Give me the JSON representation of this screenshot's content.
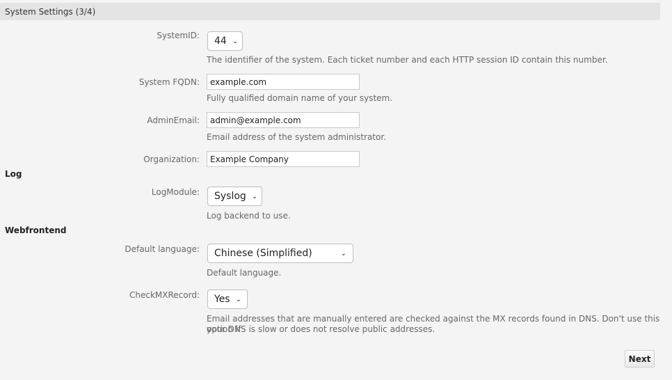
{
  "panel": {
    "title": "System Settings (3/4)"
  },
  "fields": {
    "system_id": {
      "label": "SystemID:",
      "value": "44",
      "help": "The identifier of the system. Each ticket number and each HTTP session ID contain this number."
    },
    "fqdn": {
      "label": "System FQDN:",
      "value": "example.com",
      "help": "Fully qualified domain name of your system."
    },
    "admin_email": {
      "label": "AdminEmail:",
      "value": "admin@example.com",
      "help": "Email address of the system administrator."
    },
    "organization": {
      "label": "Organization:",
      "value": "Example Company"
    },
    "log_module": {
      "label": "LogModule:",
      "value": "Syslog",
      "help": "Log backend to use."
    },
    "default_language": {
      "label": "Default language:",
      "value": "Chinese (Simplified)",
      "help": "Default language."
    },
    "check_mx": {
      "label": "CheckMXRecord:",
      "value": "Yes",
      "help_line1": "Email addresses that are manually entered are checked against the MX records found in DNS. Don't use this option if",
      "help_line2": "your DNS is slow or does not resolve public addresses."
    }
  },
  "sections": {
    "log": "Log",
    "webfrontend": "Webfrontend"
  },
  "buttons": {
    "next": "Next"
  },
  "icons": {
    "dropdown": "chevron-down-icon"
  }
}
